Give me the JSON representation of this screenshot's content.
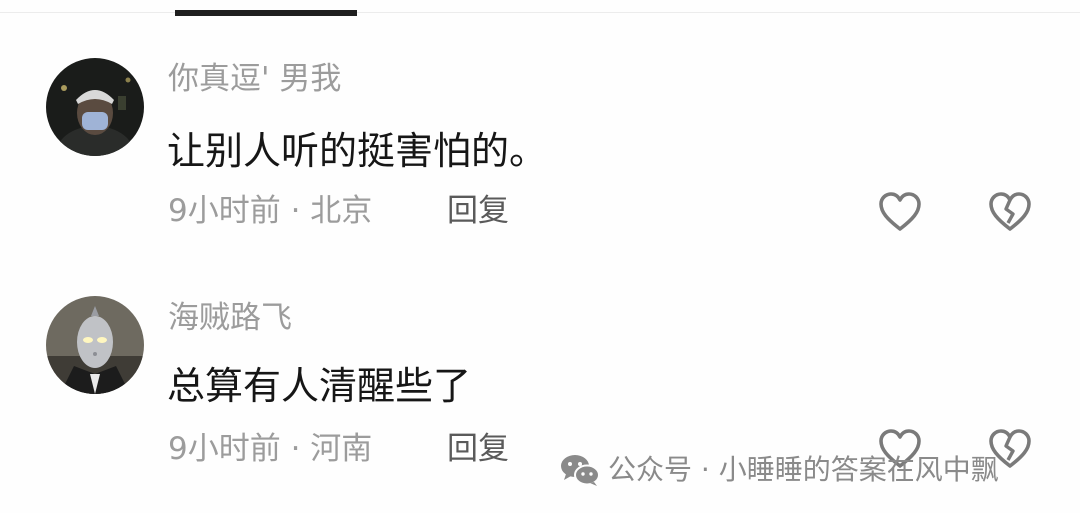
{
  "tabs": {
    "active_indicator": "active-tab"
  },
  "comments": [
    {
      "username": "你真逗' 男我",
      "text": "让别人听的挺害怕的。",
      "meta": "9小时前 · 北京",
      "reply_label": "回复",
      "avatar_icon": "masked-person-avatar",
      "like_icon": "heart-outline-icon",
      "dislike_icon": "broken-heart-icon"
    },
    {
      "username": "海贼路飞",
      "text": "总算有人清醒些了",
      "meta": "9小时前 · 河南",
      "reply_label": "回复",
      "avatar_icon": "ultraman-avatar",
      "like_icon": "heart-outline-icon",
      "dislike_icon": "broken-heart-icon"
    }
  ],
  "watermark": {
    "icon": "wechat-icon",
    "text": "公众号 · 小睡睡的答案在风中飘"
  },
  "colors": {
    "background": "#fefefe",
    "text_primary": "#161616",
    "text_secondary": "#9c9c9c",
    "icon_stroke": "#7a7a7a"
  }
}
